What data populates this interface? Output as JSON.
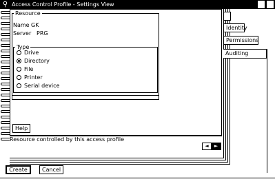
{
  "window": {
    "title": "Access Control Profile - Settings View",
    "system_menu_icon": "lock-icon"
  },
  "tabs": [
    {
      "label": "",
      "selected": false
    },
    {
      "label": "Identity",
      "selected": false
    },
    {
      "label": "Permissions",
      "selected": false
    },
    {
      "label": "Auditing",
      "selected": true
    }
  ],
  "resource": {
    "legend": "Resource",
    "name_label": "Name",
    "name_value": "GK",
    "server_label": "Server",
    "server_value": "PRG"
  },
  "type": {
    "legend": "Type",
    "options": [
      {
        "label": "Drive",
        "checked": false
      },
      {
        "label": "Directory",
        "checked": true
      },
      {
        "label": "File",
        "checked": false
      },
      {
        "label": "Printer",
        "checked": false
      },
      {
        "label": "Serial device",
        "checked": false
      }
    ]
  },
  "buttons": {
    "help": "Help",
    "create": "Create",
    "cancel": "Cancel"
  },
  "status": {
    "text": "Resource controlled by this access profile"
  },
  "page_nav": {
    "prev_icon": "page-back-icon",
    "next_icon": "page-forward-icon",
    "prev_glyph": "◄",
    "next_glyph": "►"
  }
}
